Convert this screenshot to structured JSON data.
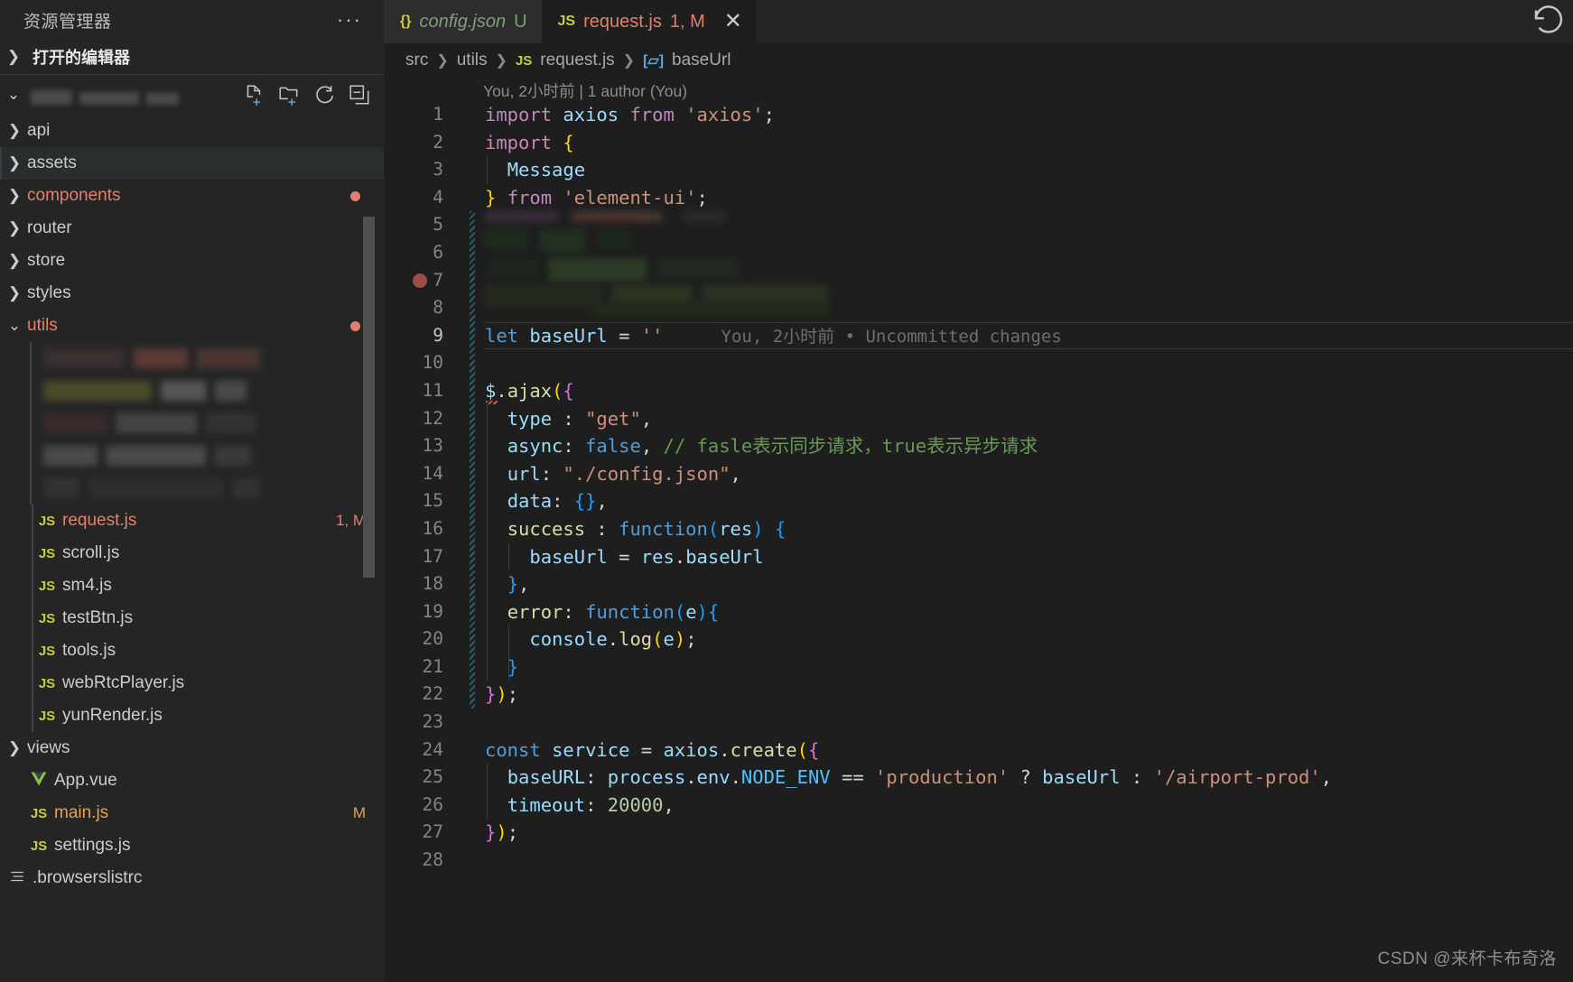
{
  "sidebar": {
    "title": "资源管理器",
    "more_label": "···",
    "open_editors_label": "打开的编辑器",
    "open_editors_chevron": "❯",
    "root_chevron": "⌄",
    "actions": [
      {
        "name": "new-file-icon",
        "label": "新建文件"
      },
      {
        "name": "new-folder-icon",
        "label": "新建文件夹"
      },
      {
        "name": "refresh-icon",
        "label": "刷新资源管理器"
      },
      {
        "name": "collapse-all-icon",
        "label": "在资源管理器中折叠文件夹"
      }
    ],
    "tree": [
      {
        "id": "api",
        "label": "api",
        "kind": "folder",
        "expanded": false,
        "depth": 1,
        "state": "normal",
        "badge": ""
      },
      {
        "id": "assets",
        "label": "assets",
        "kind": "folder",
        "expanded": false,
        "depth": 1,
        "state": "normal",
        "badge": "",
        "highlight": true
      },
      {
        "id": "components",
        "label": "components",
        "kind": "folder",
        "expanded": false,
        "depth": 1,
        "state": "modified",
        "badge": "",
        "dot": "#e2806e"
      },
      {
        "id": "router",
        "label": "router",
        "kind": "folder",
        "expanded": false,
        "depth": 1,
        "state": "normal",
        "badge": ""
      },
      {
        "id": "store",
        "label": "store",
        "kind": "folder",
        "expanded": false,
        "depth": 1,
        "state": "normal",
        "badge": ""
      },
      {
        "id": "styles",
        "label": "styles",
        "kind": "folder",
        "expanded": false,
        "depth": 1,
        "state": "normal",
        "badge": ""
      },
      {
        "id": "utils",
        "label": "utils",
        "kind": "folder",
        "expanded": true,
        "depth": 1,
        "state": "modified",
        "badge": "",
        "dot": "#e2806e"
      },
      {
        "id": "redacted-1",
        "label": "",
        "kind": "redacted",
        "depth": 2
      },
      {
        "id": "redacted-2",
        "label": "",
        "kind": "redacted",
        "depth": 2
      },
      {
        "id": "redacted-3",
        "label": "",
        "kind": "redacted",
        "depth": 2
      },
      {
        "id": "redacted-4",
        "label": "",
        "kind": "redacted",
        "depth": 2
      },
      {
        "id": "redacted-5",
        "label": "",
        "kind": "redacted",
        "depth": 2
      },
      {
        "id": "request-js",
        "label": "request.js",
        "kind": "js",
        "depth": 2,
        "state": "modified",
        "badge": "1, M"
      },
      {
        "id": "scroll-js",
        "label": "scroll.js",
        "kind": "js",
        "depth": 2,
        "state": "normal",
        "badge": ""
      },
      {
        "id": "sm4-js",
        "label": "sm4.js",
        "kind": "js",
        "depth": 2,
        "state": "normal",
        "badge": ""
      },
      {
        "id": "testbtn-js",
        "label": "testBtn.js",
        "kind": "js",
        "depth": 2,
        "state": "normal",
        "badge": ""
      },
      {
        "id": "tools-js",
        "label": "tools.js",
        "kind": "js",
        "depth": 2,
        "state": "normal",
        "badge": ""
      },
      {
        "id": "webrtcplayer-js",
        "label": "webRtcPlayer.js",
        "kind": "js",
        "depth": 2,
        "state": "normal",
        "badge": ""
      },
      {
        "id": "yunrender-js",
        "label": "yunRender.js",
        "kind": "js",
        "depth": 2,
        "state": "normal",
        "badge": ""
      },
      {
        "id": "views",
        "label": "views",
        "kind": "folder",
        "expanded": false,
        "depth": 1,
        "state": "normal",
        "badge": ""
      },
      {
        "id": "app-vue",
        "label": "App.vue",
        "kind": "vue",
        "depth": 1,
        "state": "normal",
        "badge": ""
      },
      {
        "id": "main-js",
        "label": "main.js",
        "kind": "js",
        "depth": 1,
        "state": "modifiedM",
        "badge": "M"
      },
      {
        "id": "settings-js",
        "label": "settings.js",
        "kind": "js",
        "depth": 1,
        "state": "normal",
        "badge": ""
      },
      {
        "id": "browserslistrc",
        "label": ".browserslistrc",
        "kind": "conf",
        "depth": 0,
        "state": "normal",
        "badge": ""
      }
    ]
  },
  "editor": {
    "tabs": [
      {
        "id": "config-json",
        "icon": "{}",
        "label": "config.json",
        "status": "U",
        "active": false,
        "color": "#7f9e7a"
      },
      {
        "id": "request-js",
        "icon": "JS",
        "label": "request.js",
        "status": "1, M",
        "active": true,
        "color": "#e2806e",
        "close": "✕"
      }
    ],
    "history_icon": "history-refresh-icon",
    "breadcrumb": [
      {
        "label": "src",
        "kind": "text"
      },
      {
        "label": "utils",
        "kind": "text"
      },
      {
        "label": "request.js",
        "kind": "js"
      },
      {
        "label": "baseUrl",
        "kind": "symbol"
      }
    ],
    "breadcrumb_sep": "❯",
    "blame_header": "You, 2小时前 | 1 author (You)",
    "inline_blame": "You, 2小时前 • Uncommitted changes",
    "active_line": 9,
    "breakpoint_line": 7,
    "lines": [
      {
        "n": 1,
        "tokens": [
          {
            "t": "import",
            "c": "t-kw"
          },
          {
            "t": " "
          },
          {
            "t": "axios",
            "c": "t-var"
          },
          {
            "t": " "
          },
          {
            "t": "from",
            "c": "t-kw"
          },
          {
            "t": " "
          },
          {
            "t": "'axios'",
            "c": "t-str"
          },
          {
            "t": ";",
            "c": "t-plain"
          }
        ]
      },
      {
        "n": 2,
        "tokens": [
          {
            "t": "import",
            "c": "t-kw"
          },
          {
            "t": " "
          },
          {
            "t": "{",
            "c": "t-y"
          }
        ]
      },
      {
        "n": 3,
        "tokens": [
          {
            "t": "  "
          },
          {
            "t": "Message",
            "c": "t-var"
          }
        ]
      },
      {
        "n": 4,
        "tokens": [
          {
            "t": "}",
            "c": "t-y"
          },
          {
            "t": " "
          },
          {
            "t": "from",
            "c": "t-kw"
          },
          {
            "t": " "
          },
          {
            "t": "'element-ui'",
            "c": "t-str"
          },
          {
            "t": ";",
            "c": "t-plain"
          }
        ]
      },
      {
        "n": 5,
        "redacted": true,
        "tokens": []
      },
      {
        "n": 6,
        "redacted": true,
        "tokens": []
      },
      {
        "n": 7,
        "redacted": true,
        "tokens": []
      },
      {
        "n": 8,
        "tokens": []
      },
      {
        "n": 9,
        "tokens": [
          {
            "t": "let",
            "c": "t-kw2"
          },
          {
            "t": " "
          },
          {
            "t": "baseUrl",
            "c": "t-var"
          },
          {
            "t": " "
          },
          {
            "t": "=",
            "c": "t-plain"
          },
          {
            "t": " "
          },
          {
            "t": "''",
            "c": "t-str"
          }
        ]
      },
      {
        "n": 10,
        "tokens": []
      },
      {
        "n": 11,
        "tokens": [
          {
            "t": "$",
            "c": "t-var"
          },
          {
            "t": ".",
            "c": "t-plain"
          },
          {
            "t": "ajax",
            "c": "t-fn"
          },
          {
            "t": "(",
            "c": "t-y"
          },
          {
            "t": "{",
            "c": "t-p"
          }
        ]
      },
      {
        "n": 12,
        "tokens": [
          {
            "t": "  "
          },
          {
            "t": "type",
            "c": "t-var"
          },
          {
            "t": " : ",
            "c": "t-plain"
          },
          {
            "t": "\"get\"",
            "c": "t-str"
          },
          {
            "t": ",",
            "c": "t-plain"
          }
        ]
      },
      {
        "n": 13,
        "tokens": [
          {
            "t": "  "
          },
          {
            "t": "async",
            "c": "t-var"
          },
          {
            "t": ": ",
            "c": "t-plain"
          },
          {
            "t": "false",
            "c": "t-kw2"
          },
          {
            "t": ", ",
            "c": "t-plain"
          },
          {
            "t": "// fasle表示同步请求，true表示异步请求",
            "c": "t-cmt"
          }
        ]
      },
      {
        "n": 14,
        "tokens": [
          {
            "t": "  "
          },
          {
            "t": "url",
            "c": "t-var"
          },
          {
            "t": ": ",
            "c": "t-plain"
          },
          {
            "t": "\"./config.json\"",
            "c": "t-str"
          },
          {
            "t": ",",
            "c": "t-plain"
          }
        ]
      },
      {
        "n": 15,
        "tokens": [
          {
            "t": "  "
          },
          {
            "t": "data",
            "c": "t-var"
          },
          {
            "t": ": ",
            "c": "t-plain"
          },
          {
            "t": "{}",
            "c": "t-b"
          },
          {
            "t": ",",
            "c": "t-plain"
          }
        ]
      },
      {
        "n": 16,
        "tokens": [
          {
            "t": "  "
          },
          {
            "t": "success",
            "c": "t-fn"
          },
          {
            "t": " : ",
            "c": "t-plain"
          },
          {
            "t": "function",
            "c": "t-kw2"
          },
          {
            "t": "(",
            "c": "t-b"
          },
          {
            "t": "res",
            "c": "t-var"
          },
          {
            "t": ")",
            "c": "t-b"
          },
          {
            "t": " "
          },
          {
            "t": "{",
            "c": "t-b"
          }
        ]
      },
      {
        "n": 17,
        "tokens": [
          {
            "t": "    "
          },
          {
            "t": "baseUrl",
            "c": "t-var"
          },
          {
            "t": " = ",
            "c": "t-plain"
          },
          {
            "t": "res",
            "c": "t-var"
          },
          {
            "t": ".",
            "c": "t-plain"
          },
          {
            "t": "baseUrl",
            "c": "t-var"
          }
        ]
      },
      {
        "n": 18,
        "tokens": [
          {
            "t": "  "
          },
          {
            "t": "}",
            "c": "t-b"
          },
          {
            "t": ",",
            "c": "t-plain"
          }
        ]
      },
      {
        "n": 19,
        "tokens": [
          {
            "t": "  "
          },
          {
            "t": "error",
            "c": "t-fn"
          },
          {
            "t": ": ",
            "c": "t-plain"
          },
          {
            "t": "function",
            "c": "t-kw2"
          },
          {
            "t": "(",
            "c": "t-b"
          },
          {
            "t": "e",
            "c": "t-var"
          },
          {
            "t": ")",
            "c": "t-b"
          },
          {
            "t": "{",
            "c": "t-b"
          }
        ]
      },
      {
        "n": 20,
        "tokens": [
          {
            "t": "    "
          },
          {
            "t": "console",
            "c": "t-var"
          },
          {
            "t": ".",
            "c": "t-plain"
          },
          {
            "t": "log",
            "c": "t-fn"
          },
          {
            "t": "(",
            "c": "t-y"
          },
          {
            "t": "e",
            "c": "t-var"
          },
          {
            "t": ")",
            "c": "t-y"
          },
          {
            "t": ";",
            "c": "t-plain"
          }
        ]
      },
      {
        "n": 21,
        "tokens": [
          {
            "t": "  "
          },
          {
            "t": "}",
            "c": "t-b"
          }
        ]
      },
      {
        "n": 22,
        "tokens": [
          {
            "t": "}",
            "c": "t-p"
          },
          {
            "t": ")",
            "c": "t-y"
          },
          {
            "t": ";",
            "c": "t-plain"
          }
        ]
      },
      {
        "n": 23,
        "tokens": []
      },
      {
        "n": 24,
        "tokens": [
          {
            "t": "const",
            "c": "t-kw2"
          },
          {
            "t": " "
          },
          {
            "t": "service",
            "c": "t-var"
          },
          {
            "t": " = ",
            "c": "t-plain"
          },
          {
            "t": "axios",
            "c": "t-var"
          },
          {
            "t": ".",
            "c": "t-plain"
          },
          {
            "t": "create",
            "c": "t-fn"
          },
          {
            "t": "(",
            "c": "t-y"
          },
          {
            "t": "{",
            "c": "t-p"
          }
        ]
      },
      {
        "n": 25,
        "tokens": [
          {
            "t": "  "
          },
          {
            "t": "baseURL",
            "c": "t-var"
          },
          {
            "t": ": ",
            "c": "t-plain"
          },
          {
            "t": "process",
            "c": "t-var"
          },
          {
            "t": ".",
            "c": "t-plain"
          },
          {
            "t": "env",
            "c": "t-var"
          },
          {
            "t": ".",
            "c": "t-plain"
          },
          {
            "t": "NODE_ENV",
            "c": "t-dim"
          },
          {
            "t": " == ",
            "c": "t-plain"
          },
          {
            "t": "'production'",
            "c": "t-str"
          },
          {
            "t": " ? ",
            "c": "t-plain"
          },
          {
            "t": "baseUrl",
            "c": "t-var"
          },
          {
            "t": " : ",
            "c": "t-plain"
          },
          {
            "t": "'/airport-prod'",
            "c": "t-str"
          },
          {
            "t": ",",
            "c": "t-plain"
          }
        ]
      },
      {
        "n": 26,
        "tokens": [
          {
            "t": "  "
          },
          {
            "t": "timeout",
            "c": "t-var"
          },
          {
            "t": ": ",
            "c": "t-plain"
          },
          {
            "t": "20000",
            "c": "t-num"
          },
          {
            "t": ",",
            "c": "t-plain"
          }
        ]
      },
      {
        "n": 27,
        "tokens": [
          {
            "t": "}",
            "c": "t-p"
          },
          {
            "t": ")",
            "c": "t-y"
          },
          {
            "t": ";",
            "c": "t-plain"
          }
        ]
      },
      {
        "n": 28,
        "tokens": []
      }
    ]
  },
  "watermark": "CSDN @来杯卡布奇洛",
  "colors": {
    "background": "#1e1e1e",
    "sidebar_bg": "#252526",
    "tab_inactive_bg": "#2d2d2d",
    "modified": "#e2806e",
    "untracked": "#7f9e7a",
    "js_icon": "#cbcb41",
    "vue_icon": "#8dc149"
  }
}
